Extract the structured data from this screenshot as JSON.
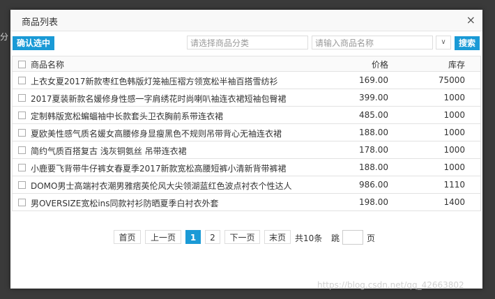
{
  "background": {
    "edge_text": "分",
    "watermark": "https://blog.csdn.net/qq_42663802"
  },
  "dialog": {
    "title": "商品列表",
    "close_symbol": "×"
  },
  "toolbar": {
    "confirm_label": "确认选中",
    "category_placeholder": "请选择商品分类",
    "name_placeholder": "请输入商品名称",
    "dropdown_symbol": "∨",
    "search_label": "搜索"
  },
  "table": {
    "headers": {
      "name": "商品名称",
      "price": "价格",
      "stock": "库存"
    },
    "rows": [
      {
        "name": "上衣女夏2017新款枣红色韩版灯笼袖压褶方领宽松半袖百搭雪纺衫",
        "price": "169.00",
        "stock": "75000"
      },
      {
        "name": "2017夏装新款名媛修身性感一字肩绣花时尚喇叭袖连衣裙短袖包臀裙",
        "price": "399.00",
        "stock": "1000"
      },
      {
        "name": "定制韩版宽松蝙蝠袖中长款套头卫衣胸前系带连衣裙",
        "price": "485.00",
        "stock": "1000"
      },
      {
        "name": "夏欧美性感气质名媛女高腰修身显瘦黑色不规则吊带背心无袖连衣裙",
        "price": "188.00",
        "stock": "1000"
      },
      {
        "name": "简约气质百搭复古 浅灰铜氨丝 吊带连衣裙",
        "price": "178.00",
        "stock": "1000"
      },
      {
        "name": "小鹿要飞背带牛仔裤女春夏季2017新款宽松高腰短裤小清新背带裤裙",
        "price": "188.00",
        "stock": "1000"
      },
      {
        "name": "DOMO男士高端衬衣潮男雅痞英伦风大尖领湖蓝红色波点衬衣个性达人",
        "price": "986.00",
        "stock": "1110"
      },
      {
        "name": "男OVERSIZE宽松ins同款衬衫防晒夏季白衬衣外套",
        "price": "198.00",
        "stock": "1400"
      }
    ]
  },
  "pager": {
    "first": "首页",
    "prev": "上一页",
    "page1": "1",
    "page2": "2",
    "next": "下一页",
    "last": "末页",
    "total": "共10条",
    "jump": "跳",
    "page_unit": "页"
  },
  "colors": {
    "accent": "#1a9ad6"
  }
}
